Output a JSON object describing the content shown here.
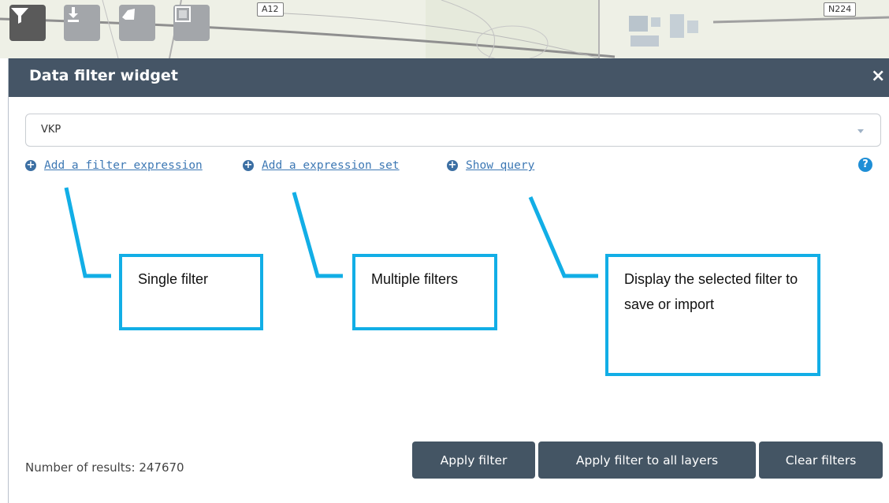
{
  "map": {
    "road_labels": [
      "A12",
      "N224"
    ],
    "toolbar": [
      {
        "icon": "filter-icon",
        "active": true
      },
      {
        "icon": "download-icon",
        "active": false
      },
      {
        "icon": "shape-icon",
        "active": false
      },
      {
        "icon": "map-frame-icon",
        "active": false
      }
    ]
  },
  "widget": {
    "title": "Data filter widget",
    "close_label": "×",
    "layer_select": {
      "value": "VKP"
    },
    "links": {
      "add_filter": "Add a filter expression",
      "add_set": "Add a expression set",
      "show_query": "Show query"
    },
    "help_label": "?",
    "results_label": "Number of results: 247670",
    "buttons": {
      "apply": "Apply filter",
      "apply_all": "Apply filter to all layers",
      "clear": "Clear filters"
    }
  },
  "annotations": {
    "single": "Single filter",
    "multiple": "Multiple filters",
    "display": "Display the selected filter to save or import"
  },
  "colors": {
    "header_bg": "#455566",
    "button_bg": "#445564",
    "link": "#3d78b4",
    "annotation": "#12aee6",
    "help": "#1e8ed6"
  }
}
